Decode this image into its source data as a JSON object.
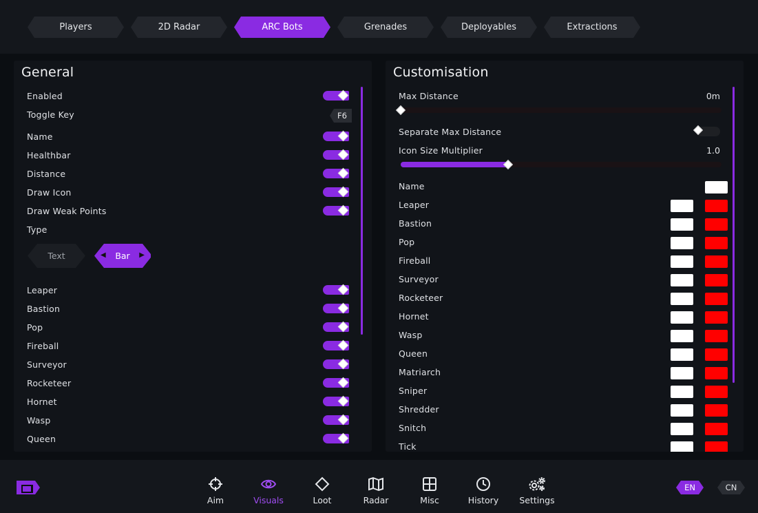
{
  "tabs": [
    "Players",
    "2D Radar",
    "ARC Bots",
    "Grenades",
    "Deployables",
    "Extractions"
  ],
  "active_tab": "ARC Bots",
  "general": {
    "title": "General",
    "enabled_label": "Enabled",
    "toggle_key_label": "Toggle Key",
    "toggle_key_value": "F6",
    "options": [
      "Name",
      "Healthbar",
      "Distance",
      "Draw Icon",
      "Draw Weak Points"
    ],
    "type_label": "Type",
    "type_options": [
      "Text",
      "Bar"
    ],
    "type_selected": "Bar",
    "bots": [
      "Leaper",
      "Bastion",
      "Pop",
      "Fireball",
      "Surveyor",
      "Rocketeer",
      "Hornet",
      "Wasp",
      "Queen"
    ]
  },
  "customisation": {
    "title": "Customisation",
    "max_distance_label": "Max Distance",
    "max_distance_value": "0m",
    "max_distance_fraction": 0.0,
    "separate_max_distance_label": "Separate Max Distance",
    "separate_max_distance_on": false,
    "icon_size_label": "Icon Size Multiplier",
    "icon_size_value": "1.0",
    "icon_size_fraction": 0.34,
    "name_label": "Name",
    "bots": [
      "Leaper",
      "Bastion",
      "Pop",
      "Fireball",
      "Surveyor",
      "Rocketeer",
      "Hornet",
      "Wasp",
      "Queen",
      "Matriarch",
      "Sniper",
      "Shredder",
      "Snitch",
      "Tick"
    ],
    "color_primary": "#ffffff",
    "color_secondary": "#ff0000"
  },
  "nav": [
    {
      "label": "Aim",
      "icon": "crosshair-icon"
    },
    {
      "label": "Visuals",
      "icon": "eye-icon"
    },
    {
      "label": "Loot",
      "icon": "diamond-icon"
    },
    {
      "label": "Radar",
      "icon": "map-icon"
    },
    {
      "label": "Misc",
      "icon": "grid-icon"
    },
    {
      "label": "History",
      "icon": "clock-icon"
    },
    {
      "label": "Settings",
      "icon": "gears-icon"
    }
  ],
  "nav_active": "Visuals",
  "languages": [
    "EN",
    "CN"
  ],
  "language_active": "EN",
  "accent_color": "#8a2be2"
}
